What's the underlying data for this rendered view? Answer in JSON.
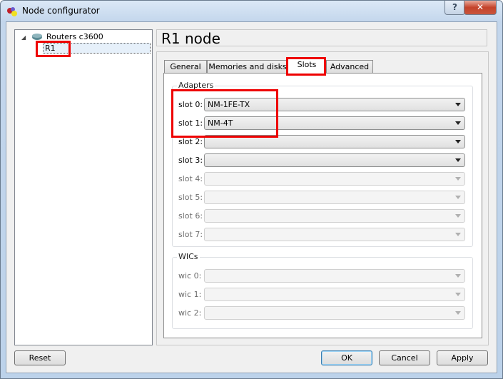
{
  "window": {
    "title": "Node configurator",
    "help_label": "?",
    "close_label": "✕"
  },
  "tree": {
    "group": "Routers c3600",
    "items": [
      {
        "label": "R1",
        "selected": true
      }
    ]
  },
  "header": {
    "title": "R1 node"
  },
  "tabs": [
    {
      "label": "General"
    },
    {
      "label": "Memories and disks"
    },
    {
      "label": "Slots",
      "active": true
    },
    {
      "label": "Advanced"
    }
  ],
  "adapters": {
    "title": "Adapters",
    "slots": [
      {
        "label": "slot 0:",
        "value": "NM-1FE-TX",
        "enabled": true
      },
      {
        "label": "slot 1:",
        "value": "NM-4T",
        "enabled": true
      },
      {
        "label": "slot 2:",
        "value": "",
        "enabled": true
      },
      {
        "label": "slot 3:",
        "value": "",
        "enabled": true
      },
      {
        "label": "slot 4:",
        "value": "",
        "enabled": false
      },
      {
        "label": "slot 5:",
        "value": "",
        "enabled": false
      },
      {
        "label": "slot 6:",
        "value": "",
        "enabled": false
      },
      {
        "label": "slot 7:",
        "value": "",
        "enabled": false
      }
    ]
  },
  "wics": {
    "title": "WICs",
    "slots": [
      {
        "label": "wic 0:",
        "value": ""
      },
      {
        "label": "wic 1:",
        "value": ""
      },
      {
        "label": "wic 2:",
        "value": ""
      }
    ]
  },
  "buttons": {
    "reset": "Reset",
    "ok": "OK",
    "cancel": "Cancel",
    "apply": "Apply"
  },
  "colors": {
    "highlight": "#ee0000"
  }
}
